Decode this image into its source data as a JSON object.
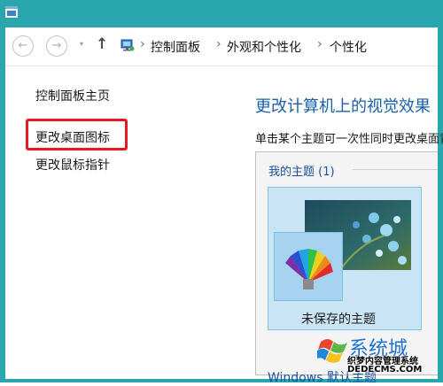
{
  "breadcrumb": {
    "items": [
      "控制面板",
      "外观和个性化",
      "个性化"
    ],
    "separator": "›"
  },
  "nav": {
    "back_glyph": "←",
    "forward_glyph": "→",
    "recent_glyph": "▾",
    "up_glyph": "↑"
  },
  "sidebar": {
    "items": [
      {
        "label": "控制面板主页"
      },
      {
        "label": "更改桌面图标",
        "highlighted": true
      },
      {
        "label": "更改鼠标指针"
      }
    ]
  },
  "main": {
    "title": "更改计算机上的视觉效果",
    "description": "单击某个主题可一次性同时更改桌面背景",
    "group_label": "我的主题 (1)",
    "theme_name": "未保存的主题",
    "next_group_label": "Windows 默认主题"
  },
  "watermark": {
    "big_text": "系统城",
    "line1": "织梦内容管理系统",
    "line2": "DEDECMS.COM"
  },
  "colors": {
    "frame": "#2aa6ae",
    "highlight": "#e11b22",
    "title": "#1b5fa8",
    "tile": "#c9e4f5"
  },
  "icons": [
    "app-icon",
    "back-icon",
    "forward-icon",
    "up-icon",
    "control-panel-icon",
    "color-fan-icon",
    "windows-logo-icon"
  ]
}
